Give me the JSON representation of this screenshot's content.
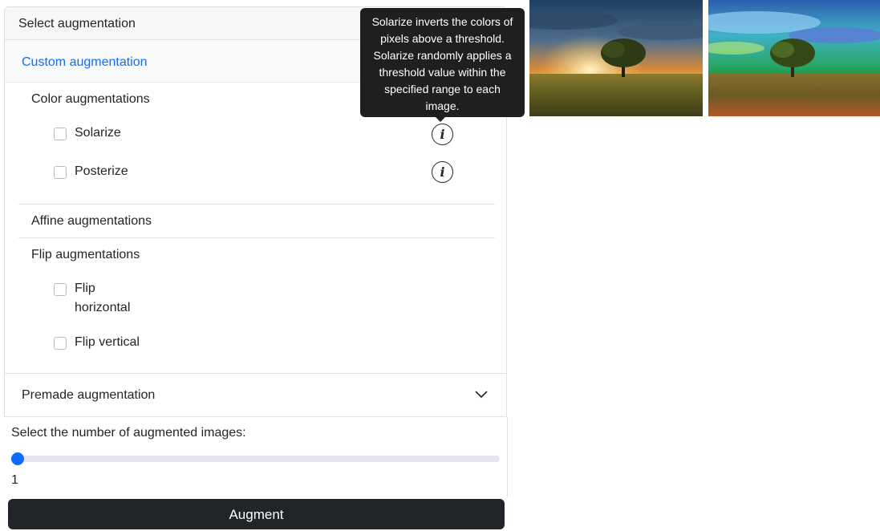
{
  "panel": {
    "header": "Select augmentation",
    "custom": {
      "title": "Custom augmentation",
      "color": {
        "title": "Color augmentations",
        "items": [
          {
            "label": "Solarize",
            "checked": false,
            "icon": "info-icon"
          },
          {
            "label": "Posterize",
            "checked": false,
            "icon": "info-icon"
          }
        ]
      },
      "affine": {
        "title": "Affine augmentations"
      },
      "flip": {
        "title": "Flip augmentations",
        "items": [
          {
            "label": "Flip horizontal",
            "checked": false
          },
          {
            "label": "Flip vertical",
            "checked": false
          }
        ]
      }
    },
    "premade": {
      "title": "Premade augmentation",
      "icon": "chevron-down-icon"
    }
  },
  "slider": {
    "label": "Select the number of augmented images:",
    "value": "1",
    "fraction": 0
  },
  "augment_button": "Augment",
  "tooltip": {
    "text": "Solarize inverts the colors of pixels above a threshold. Solarize randomly applies a threshold value within the specified range to each image."
  },
  "colors": {
    "accent": "#0d6efd",
    "button_bg": "#212529",
    "tooltip_bg": "#1f1f1f"
  }
}
